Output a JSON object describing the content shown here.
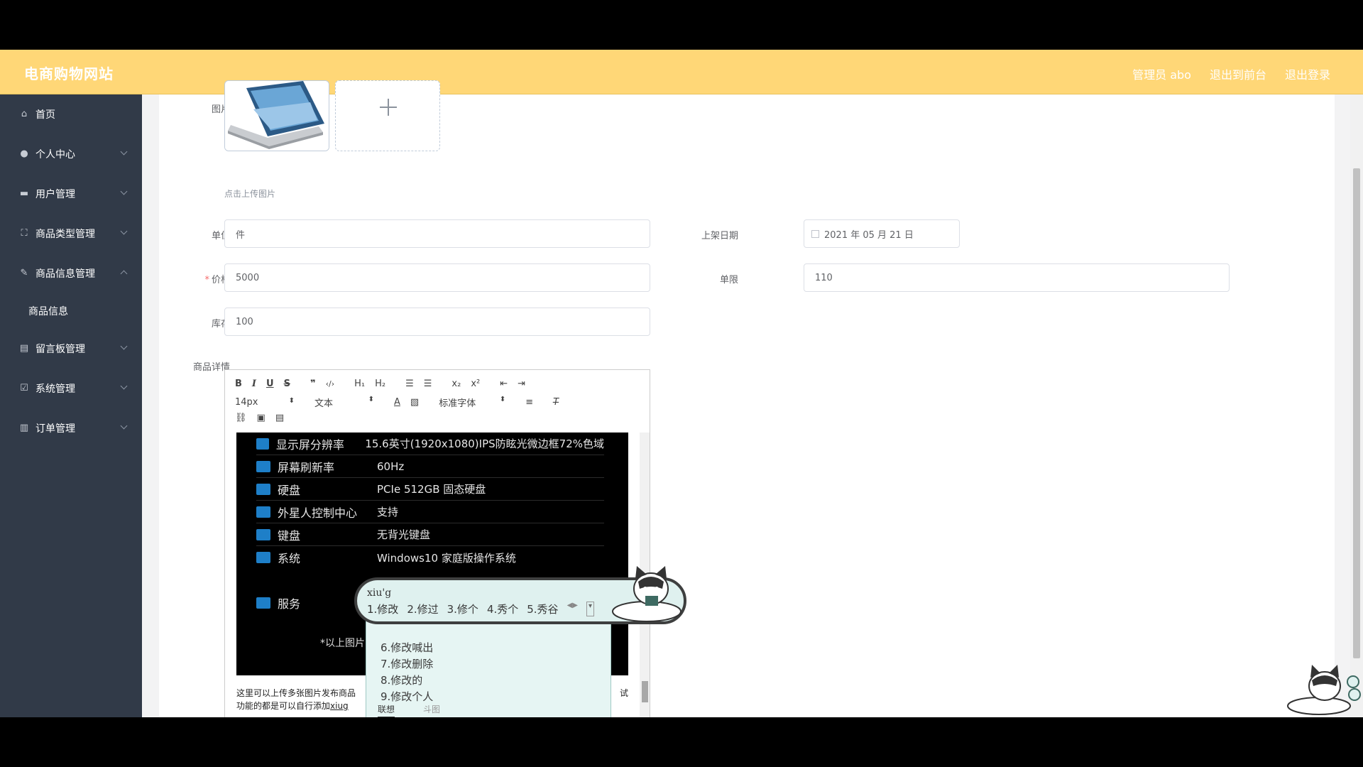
{
  "header": {
    "brand": "电商购物网站",
    "admin": "管理员 abo",
    "to_front": "退出到前台",
    "logout": "退出登录"
  },
  "sidebar": {
    "items": [
      {
        "label": "首页",
        "icon": "home-icon"
      },
      {
        "label": "个人中心",
        "icon": "user-icon"
      },
      {
        "label": "用户管理",
        "icon": "users-icon"
      },
      {
        "label": "商品类型管理",
        "icon": "category-icon"
      },
      {
        "label": "商品信息管理",
        "icon": "goods-icon"
      },
      {
        "label": "留言板管理",
        "icon": "message-icon"
      },
      {
        "label": "系统管理",
        "icon": "settings-icon"
      },
      {
        "label": "订单管理",
        "icon": "order-icon"
      }
    ],
    "sub_item": "商品信息"
  },
  "form": {
    "image_label": "图片",
    "upload_hint": "点击上传图片",
    "unit_label": "单位",
    "unit_value": "件",
    "date_label": "上架日期",
    "date_value": "2021 年 05 月 21 日",
    "price_label": "价格",
    "price_value": "5000",
    "limit_label": "单限",
    "limit_value": "110",
    "stock_label": "库存",
    "stock_value": "100",
    "detail_label": "商品详情"
  },
  "editor": {
    "toolbar": {
      "bold": "B",
      "italic": "I",
      "underline": "U",
      "strike": "S",
      "quote": "❞",
      "code": "‹/›",
      "h1": "H₁",
      "h2": "H₂",
      "sub": "x₂",
      "sup": "x²",
      "size": "14px",
      "header": "文本",
      "font": "标准字体"
    },
    "specs": [
      {
        "key": "显示屏分辨率",
        "value": "15.6英寸(1920x1080)IPS防眩光微边框72%色域"
      },
      {
        "key": "屏幕刷新率",
        "value": "60Hz"
      },
      {
        "key": "硬盘",
        "value": "PCIe 512GB 固态硬盘"
      },
      {
        "key": "外星人控制中心",
        "value": "支持"
      },
      {
        "key": "键盘",
        "value": "无背光键盘"
      },
      {
        "key": "系统",
        "value": "Windows10 家庭版操作系统"
      },
      {
        "key": "服务",
        "value": ""
      }
    ],
    "image_note": "*以上图片",
    "text_line1_a": "这里可以上传多张图片发布商品",
    "text_line1_b": "试",
    "text_line2": "功能的都是可以自行添加",
    "text_typing": "xiug"
  },
  "ime": {
    "composition": "xiu'g",
    "candidates": [
      "1.修改",
      "2.修过",
      "3.修个",
      "4.秀个",
      "5.秀谷"
    ],
    "more": [
      "6.修改喊出",
      "7.修改删除",
      "8.修改的",
      "9.修改个人"
    ],
    "tab_assoc": "联想",
    "tab_meme": "斗图"
  },
  "colors": {
    "header_bg": "#ffd777",
    "sidebar_bg": "#313a48",
    "required": "#f56c6c"
  }
}
